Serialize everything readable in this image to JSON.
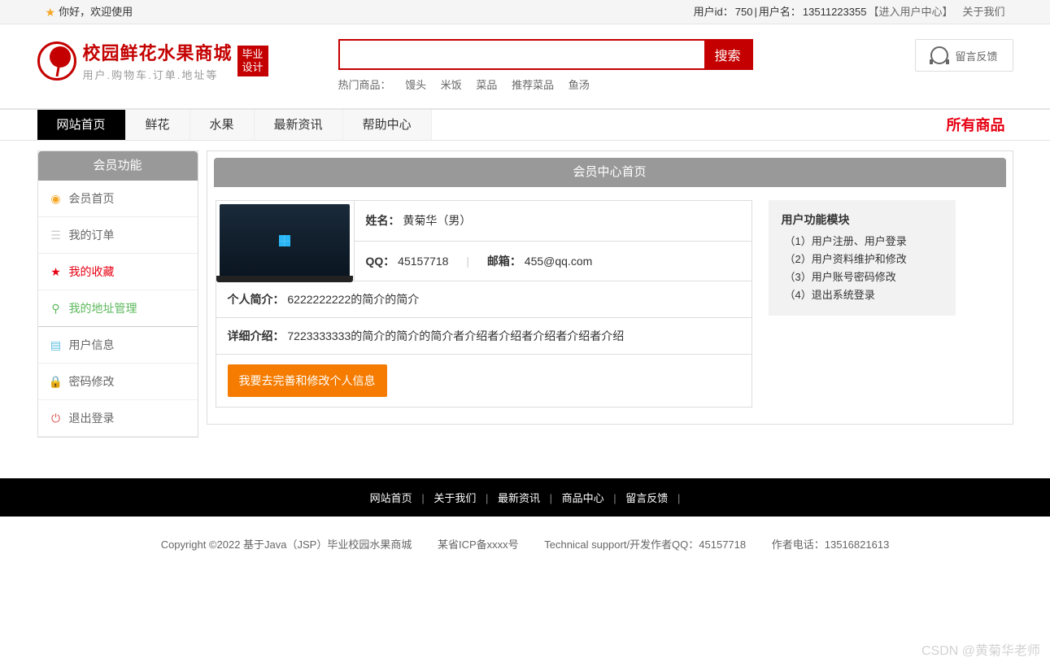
{
  "topbar": {
    "greeting": "你好，欢迎使用",
    "user_id_label": "用户id：",
    "user_id": "750",
    "sep": " | ",
    "username_label": "用户名：",
    "username": "13511223355",
    "enter_center": "【进入用户中心】",
    "about": "关于我们"
  },
  "logo": {
    "title": "校园鲜花水果商城",
    "subtitle": "用户.购物车.订单.地址等",
    "badge1": "毕业",
    "badge2": "设计"
  },
  "search": {
    "button": "搜索",
    "hot_label": "热门商品：",
    "hot": [
      "馒头",
      "米饭",
      "菜品",
      "推荐菜品",
      "鱼汤"
    ]
  },
  "feedback": {
    "label": "留言反馈"
  },
  "nav": {
    "items": [
      "网站首页",
      "鲜花",
      "水果",
      "最新资讯",
      "帮助中心"
    ],
    "all": "所有商品"
  },
  "sidebar": {
    "title": "会员功能",
    "items": [
      {
        "label": "会员首页"
      },
      {
        "label": "我的订单"
      },
      {
        "label": "我的收藏"
      },
      {
        "label": "我的地址管理"
      },
      {
        "label": "用户信息"
      },
      {
        "label": "密码修改"
      },
      {
        "label": "退出登录"
      }
    ]
  },
  "content": {
    "title": "会员中心首页",
    "name_label": "姓名：",
    "name_value": "黄菊华（男）",
    "qq_label": "QQ：",
    "qq_value": "45157718",
    "email_label": "邮箱：",
    "email_value": "455@qq.com",
    "intro_label": "个人简介：",
    "intro_value": "6222222222的简介的简介",
    "detail_label": "详细介绍：",
    "detail_value": "7223333333的简介的简介的简介者介绍者介绍者介绍者介绍者介绍",
    "edit_button": "我要去完善和修改个人信息"
  },
  "module": {
    "title": "用户功能模块",
    "lines": [
      "（1）用户注册、用户登录",
      "（2）用户资料维护和修改",
      "（3）用户账号密码修改",
      "（4）退出系统登录"
    ]
  },
  "footer": {
    "links": [
      "网站首页",
      "关于我们",
      "最新资讯",
      "商品中心",
      "留言反馈"
    ],
    "copyright": "Copyright ©2022 基于Java（JSP）毕业校园水果商城",
    "icp": "某省ICP备xxxx号",
    "tech": "Technical support/开发作者QQ：45157718",
    "phone": "作者电话：13516821613"
  },
  "watermark": "CSDN @黄菊华老师"
}
